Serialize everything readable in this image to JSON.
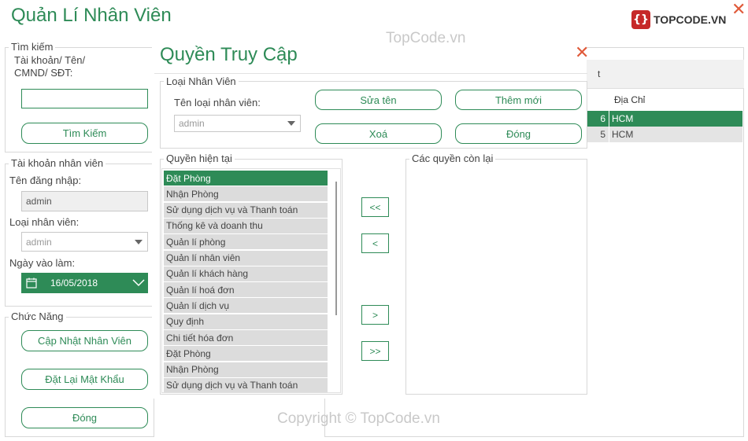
{
  "main": {
    "title": "Quản Lí Nhân Viên",
    "close_glyph": "✕",
    "logo_text": "TOPCODE.VN"
  },
  "search": {
    "legend": "Tìm kiếm",
    "label_line1": "Tài khoản/ Tên/",
    "label_line2": "CMND/ SĐT:",
    "input_value": "",
    "button": "Tìm Kiếm"
  },
  "account": {
    "legend": "Tài khoản nhân viên",
    "username_label": "Tên đăng nhập:",
    "username_value": "admin",
    "type_label": "Loại nhân viên:",
    "type_value": "admin",
    "date_label": "Ngày vào làm:",
    "date_value": "16/05/2018"
  },
  "functions": {
    "legend": "Chức Năng",
    "update_button": "Cập Nhật Nhân Viên",
    "reset_button": "Đặt Lại Mật Khẩu",
    "close_button": "Đóng"
  },
  "grid": {
    "header_partial": "t",
    "column_address": "Địa Chỉ",
    "rows": [
      {
        "id_tail": "6",
        "address": "HCM",
        "selected": true
      },
      {
        "id_tail": "5",
        "address": "HCM",
        "selected": false
      }
    ]
  },
  "dialog": {
    "title": "Quyền Truy Cập",
    "close_glyph": "✕",
    "group_legend": "Loại Nhân Viên",
    "type_label": "Tên loại nhân viên:",
    "type_value": "admin",
    "edit_button": "Sửa tên",
    "add_button": "Thêm mới",
    "delete_button": "Xoá",
    "close_button": "Đóng",
    "current_legend": "Quyền hiện tại",
    "remaining_legend": "Các quyền còn lại",
    "current_items": [
      "Đặt Phòng",
      "Nhận Phòng",
      "Sử dụng dịch vụ và Thanh toán",
      "Thống kê và doanh thu",
      "Quản lí phòng",
      "Quản lí nhân viên",
      "Quản lí khách hàng",
      "Quản lí hoá đơn",
      "Quản lí dịch vụ",
      "Quy định",
      "Chi tiết hóa đơn",
      "Đặt Phòng",
      "Nhận Phòng",
      "Sử dụng dịch vụ và Thanh toán"
    ],
    "selected_index": 0,
    "move_all_left": "<<",
    "move_left": "<",
    "move_right": ">",
    "move_all_right": ">>"
  },
  "watermark": {
    "top": "TopCode.vn",
    "bottom": "Copyright © TopCode.vn"
  },
  "colors": {
    "accent": "#2e8b57",
    "close": "#e05a3a",
    "list_bg": "#dcdcdc"
  }
}
